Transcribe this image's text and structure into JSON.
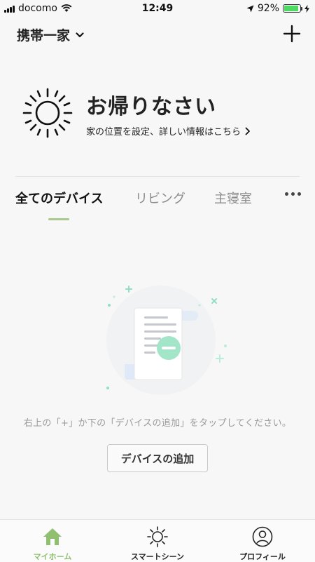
{
  "status_bar": {
    "carrier": "docomo",
    "time": "12:49",
    "battery_percent": "92%",
    "battery_level": 0.92
  },
  "header": {
    "home_name": "携帯一家",
    "add_icon": "plus-icon"
  },
  "welcome": {
    "title": "お帰りなさい",
    "link_text": "家の位置を設定、詳しい情報はこちら"
  },
  "tabs": [
    {
      "label": "全てのデバイス",
      "active": true
    },
    {
      "label": "リビング",
      "active": false
    },
    {
      "label": "主寝室",
      "active": false
    }
  ],
  "empty_state": {
    "hint": "右上の「+」か下の「デバイスの追加」をタップしてください。",
    "button_label": "デバイスの追加"
  },
  "tab_bar": [
    {
      "label": "マイホーム",
      "icon": "home-icon",
      "active": true
    },
    {
      "label": "スマートシーン",
      "icon": "sun-icon",
      "active": false
    },
    {
      "label": "プロフィール",
      "icon": "user-icon",
      "active": false
    }
  ],
  "colors": {
    "accent": "#a9c98e",
    "active_tab_label": "#8fbf6f",
    "battery": "#4cd964",
    "illustration_accent": "#8fe0c0"
  }
}
